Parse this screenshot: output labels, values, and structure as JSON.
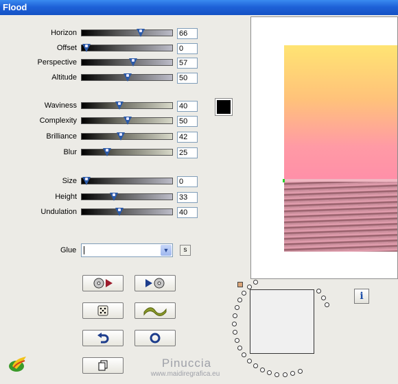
{
  "window": {
    "title": "Flood"
  },
  "sliders": [
    {
      "id": "horizon",
      "label": "Horizon",
      "value": "66",
      "level": 0.66,
      "style": "dark"
    },
    {
      "id": "offset",
      "label": "Offset",
      "value": "0",
      "level": 0.0,
      "style": "dark"
    },
    {
      "id": "perspective",
      "label": "Perspective",
      "value": "57",
      "level": 0.57,
      "style": "dark"
    },
    {
      "id": "altitude",
      "label": "Altitude",
      "value": "50",
      "level": 0.5,
      "style": "dark"
    },
    {
      "id": "waviness",
      "label": "Waviness",
      "value": "40",
      "level": 0.4,
      "style": "beige"
    },
    {
      "id": "complexity",
      "label": "Complexity",
      "value": "50",
      "level": 0.5,
      "style": "beige"
    },
    {
      "id": "brilliance",
      "label": "Brilliance",
      "value": "42",
      "level": 0.42,
      "style": "beige"
    },
    {
      "id": "blur",
      "label": "Blur",
      "value": "25",
      "level": 0.25,
      "style": "beige"
    },
    {
      "id": "size",
      "label": "Size",
      "value": "0",
      "level": 0.0,
      "style": "dark"
    },
    {
      "id": "height",
      "label": "Height",
      "value": "33",
      "level": 0.33,
      "style": "dark"
    },
    {
      "id": "undulation",
      "label": "Undulation",
      "value": "40",
      "level": 0.4,
      "style": "dark"
    }
  ],
  "color": {
    "swatch": "#000000"
  },
  "glue": {
    "label": "Glue",
    "value": "",
    "s_button": "s"
  },
  "buttons": {
    "icons": [
      "cd-prev-icon",
      "cd-next-icon",
      "dice-icon",
      "wave-icon",
      "undo-icon",
      "circle-icon",
      "copy-icon"
    ]
  },
  "info": {
    "label": "i"
  },
  "watermark": {
    "name": "Pinuccia",
    "site": "www.maidiregrafica.eu"
  }
}
